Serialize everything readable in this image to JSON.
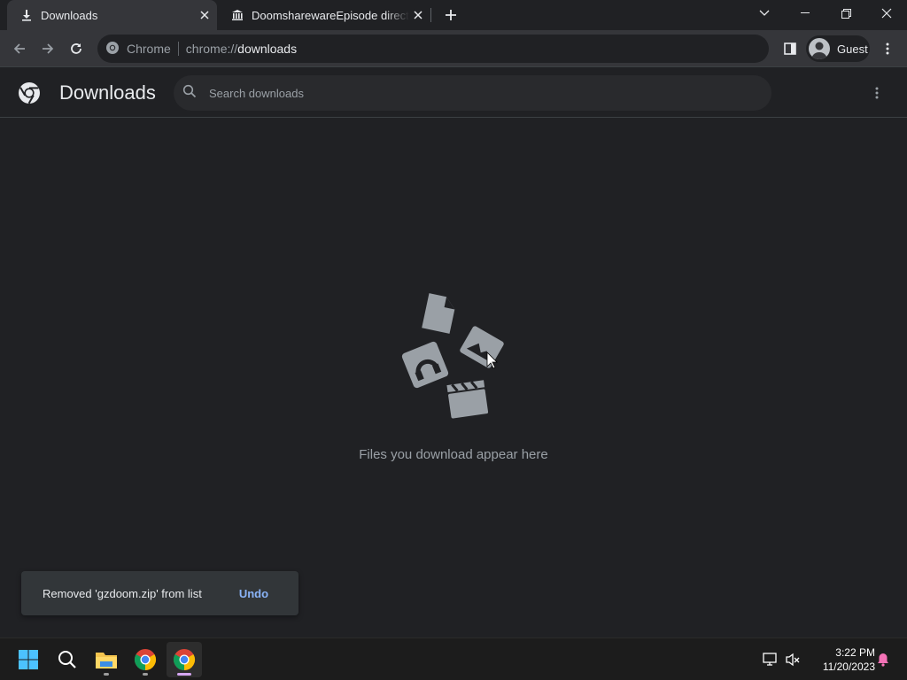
{
  "tabs": [
    {
      "title": "Downloads",
      "icon": "download-icon",
      "active": true
    },
    {
      "title": "DoomsharewareEpisode directory",
      "icon": "archive-building-icon",
      "active": false
    }
  ],
  "omnibox": {
    "chip": "Chrome",
    "url_scheme": "chrome://",
    "url_host": "downloads"
  },
  "profile": {
    "name": "Guest"
  },
  "downloads": {
    "title": "Downloads",
    "search_placeholder": "Search downloads",
    "empty_message": "Files you download appear here"
  },
  "toast": {
    "message": "Removed 'gzdoom.zip' from list",
    "action": "Undo"
  },
  "taskbar": {
    "time": "3:22 PM",
    "date": "11/20/2023"
  },
  "colors": {
    "background": "#202124",
    "toolbar": "#35363a",
    "link": "#8ab4f8",
    "muted": "#9aa0a6"
  }
}
